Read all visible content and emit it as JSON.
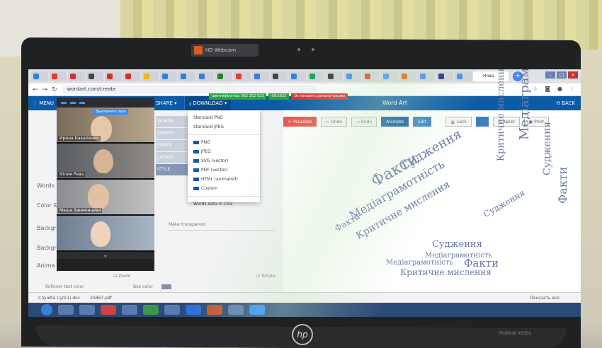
{
  "webcam": {
    "title": "HD Webcam"
  },
  "browser": {
    "url": "wordart.com/create",
    "active_tab": "Нова",
    "zoom_banner_left": "Ідентифікатор: 562 252 023",
    "zoom_banner_mid": "00:1023",
    "zoom_banner_right": "Остановить демонстрацию"
  },
  "app": {
    "menu": "MENU",
    "share": "SHARE",
    "download": "DOWNLOAD",
    "title": "Word Art",
    "back": "BACK"
  },
  "left_panel": {
    "items": [
      "WORDS",
      "SHAPES",
      "FONTS",
      "LAYOUT",
      "STYLE"
    ],
    "labels": [
      "Words",
      "Color &",
      "Backgr",
      "Backgr",
      "Anima"
    ],
    "make_transparent": "Make transparent",
    "zoom": "Zoom",
    "rotate": "Rotate",
    "rollover_text_color": "Rollover text color",
    "box_color": "Box color"
  },
  "download_menu": {
    "items": [
      "Standard PNG",
      "Standard JPEG",
      "PNG",
      "JPEG",
      "SVG (vector)",
      "PDF (vector)",
      "HTML (animated)",
      "Custom"
    ],
    "words_csv": "Words data in CSV"
  },
  "zoom_panel": {
    "mute_label": "Выключить звук",
    "participants": [
      "Ирина Бакаленко",
      "Юлия Рева",
      "Маша Занмонцева",
      ""
    ]
  },
  "toolbar": {
    "visualize": "Visualize",
    "undo": "Undo",
    "redo": "Redo",
    "animate": "Animate",
    "edit": "Edit",
    "lock": "Lock",
    "reset": "Reset",
    "print": "Print"
  },
  "wordcloud": {
    "words": [
      {
        "text": "Факти",
        "size": 22,
        "rot": -30
      },
      {
        "text": "Судження",
        "size": 18,
        "rot": -30
      },
      {
        "text": "Медіаграмотність",
        "size": 16,
        "rot": -30
      },
      {
        "text": "Критичне мислення",
        "size": 14,
        "rot": -30
      },
      {
        "text": "Медіаграмотність",
        "size": 18,
        "rot": -90
      },
      {
        "text": "Критичне мислення",
        "size": 13,
        "rot": -90
      },
      {
        "text": "Судження",
        "size": 14,
        "rot": -90
      },
      {
        "text": "Факти",
        "size": 16,
        "rot": -90
      },
      {
        "text": "Судження",
        "size": 13,
        "rot": 0
      },
      {
        "text": "Факти",
        "size": 15,
        "rot": 0
      },
      {
        "text": "Критичне мислення",
        "size": 12,
        "rot": 0
      },
      {
        "text": "Медіаграмотність",
        "size": 10,
        "rot": 0
      },
      {
        "text": "Факти",
        "size": 12,
        "rot": -30
      },
      {
        "text": "Медіаграмотність",
        "size": 10,
        "rot": 0
      },
      {
        "text": "Судження",
        "size": 12,
        "rot": -30
      }
    ]
  },
  "downloads_bar": {
    "file1": "Служба Суп(1).doc",
    "file2": "25867.pdf",
    "show_all": "Показать все"
  },
  "laptop": {
    "brand": "ProBook 4530s"
  }
}
